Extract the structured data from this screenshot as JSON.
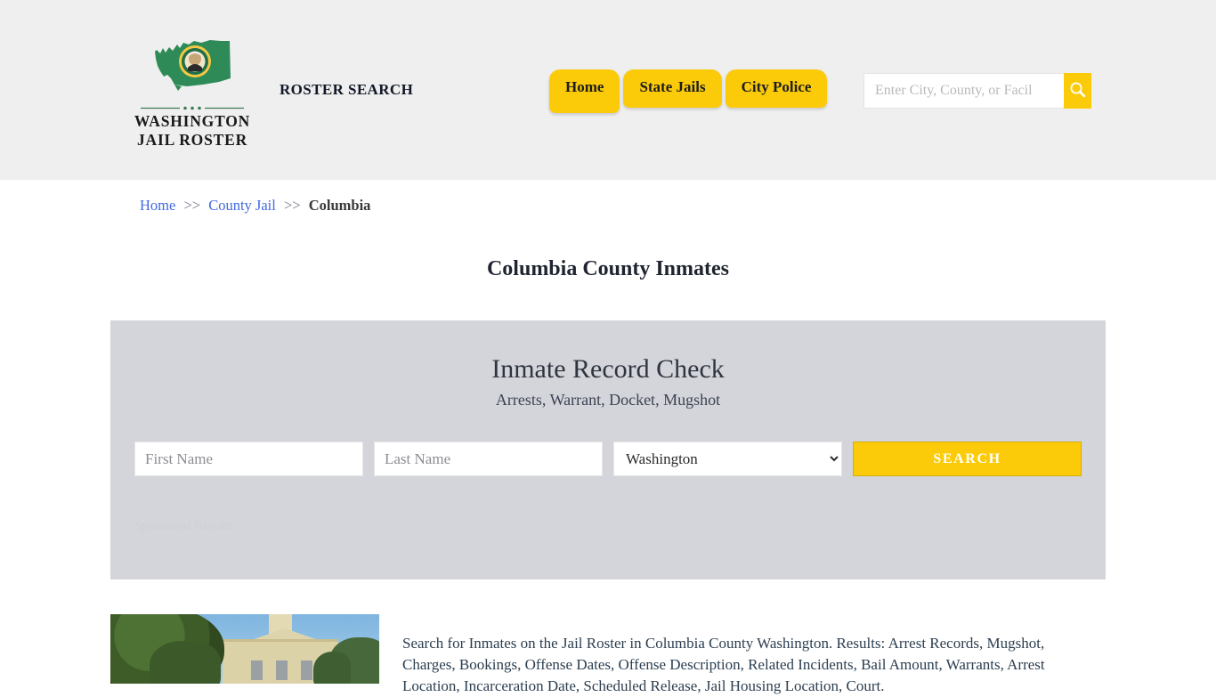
{
  "header": {
    "brand": {
      "line1": "WASHINGTON",
      "line2": "JAIL ROSTER",
      "logo_icon": "washington-state-seal-icon"
    },
    "tagline": "ROSTER SEARCH",
    "nav": [
      {
        "label": "Home"
      },
      {
        "label": "State Jails"
      },
      {
        "label": "City Police"
      }
    ],
    "search": {
      "placeholder": "Enter City, County, or Facil",
      "value": "",
      "button_icon": "search-icon"
    },
    "background_color": "#efefef",
    "accent_color": "#fbcb0a"
  },
  "breadcrumb": {
    "items": [
      {
        "label": "Home",
        "link": true
      },
      {
        "label": "County Jail",
        "link": true
      },
      {
        "label": "Columbia",
        "link": false
      }
    ],
    "separator": ">>"
  },
  "page": {
    "title": "Columbia County Inmates"
  },
  "search_panel": {
    "title": "Inmate Record Check",
    "subtitle": "Arrests, Warrant, Docket, Mugshot",
    "first_name": {
      "placeholder": "First Name",
      "value": ""
    },
    "last_name": {
      "placeholder": "Last Name",
      "value": ""
    },
    "state_select": {
      "selected": "Washington",
      "options": [
        "Washington"
      ]
    },
    "search_button": "SEARCH",
    "sponsored_note": "Sponsored Results",
    "background_color": "#d4d5da"
  },
  "content": {
    "thumbnail_alt": "columbia-county-courthouse-photo",
    "description": "Search for Inmates on the Jail Roster in Columbia County Washington. Results: Arrest Records, Mugshot, Charges, Bookings, Offense Dates, Offense Description, Related Incidents, Bail Amount, Warrants, Arrest Location, Incarceration Date, Scheduled Release, Jail Housing Location, Court."
  }
}
